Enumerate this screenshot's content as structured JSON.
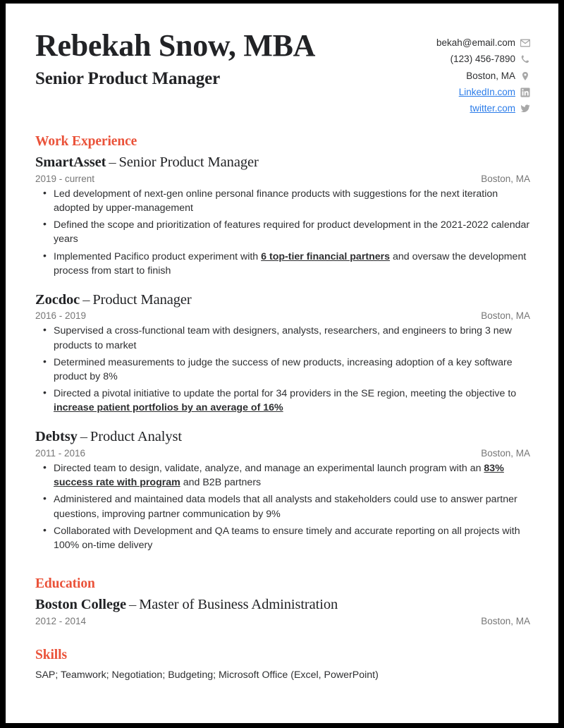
{
  "header": {
    "name": "Rebekah Snow, MBA",
    "headline": "Senior Product Manager",
    "contacts": [
      {
        "icon": "envelope-icon",
        "text": "bekah@email.com",
        "is_link": false
      },
      {
        "icon": "phone-icon",
        "text": "(123) 456-7890",
        "is_link": false
      },
      {
        "icon": "location-pin-icon",
        "text": "Boston, MA",
        "is_link": false
      },
      {
        "icon": "linkedin-icon",
        "text": "LinkedIn.com",
        "is_link": true
      },
      {
        "icon": "twitter-icon",
        "text": "twitter.com",
        "is_link": true
      }
    ]
  },
  "colors": {
    "accent": "#ea5239",
    "link": "#2b7ce9",
    "text": "#2e2f31",
    "muted": "#767676",
    "icon": "#a8a8a8"
  },
  "sections": {
    "work": {
      "title": "Work Experience",
      "entries": [
        {
          "org": "SmartAsset",
          "dash": "–",
          "role": "Senior Product Manager",
          "dates": "2019 - current",
          "location": "Boston, MA",
          "bullets": [
            {
              "pre": "Led development of next-gen online personal finance products with suggestions for the next iteration adopted by upper-management",
              "strong": "",
              "post": ""
            },
            {
              "pre": "Defined the scope and prioritization of features required for product development in the 2021-2022 calendar years",
              "strong": "",
              "post": ""
            },
            {
              "pre": "Implemented Pacifico product experiment with ",
              "strong": "6 top-tier financial partners",
              "post": " and oversaw the development process from start to finish"
            }
          ]
        },
        {
          "org": "Zocdoc",
          "dash": "–",
          "role": "Product Manager",
          "dates": "2016 - 2019",
          "location": "Boston, MA",
          "bullets": [
            {
              "pre": "Supervised a cross-functional team with designers, analysts, researchers, and engineers to bring 3 new products to market",
              "strong": "",
              "post": ""
            },
            {
              "pre": "Determined measurements to judge the success of new products, increasing adoption of a key software product by 8%",
              "strong": "",
              "post": ""
            },
            {
              "pre": "Directed a pivotal initiative to update the portal for 34 providers in the SE region, meeting the objective to ",
              "strong": "increase patient portfolios by an average of 16%",
              "post": ""
            }
          ]
        },
        {
          "org": "Debtsy",
          "dash": "–",
          "role": "Product Analyst",
          "dates": "2011 - 2016",
          "location": "Boston, MA",
          "bullets": [
            {
              "pre": "Directed team to design, validate, analyze, and manage an experimental launch program with an ",
              "strong": "83% success rate with program",
              "post": " and B2B partners"
            },
            {
              "pre": "Administered and maintained data models that all analysts and stakeholders could use to answer partner questions, improving partner communication by 9%",
              "strong": "",
              "post": ""
            },
            {
              "pre": "Collaborated with Development and QA teams to ensure timely and accurate reporting on all projects with 100% on-time delivery",
              "strong": "",
              "post": ""
            }
          ]
        }
      ]
    },
    "education": {
      "title": "Education",
      "entries": [
        {
          "org": "Boston College",
          "dash": "–",
          "role": "Master of Business Administration",
          "dates": "2012 - 2014",
          "location": "Boston, MA"
        }
      ]
    },
    "skills": {
      "title": "Skills",
      "text": "SAP; Teamwork; Negotiation; Budgeting; Microsoft Office (Excel, PowerPoint)"
    }
  }
}
